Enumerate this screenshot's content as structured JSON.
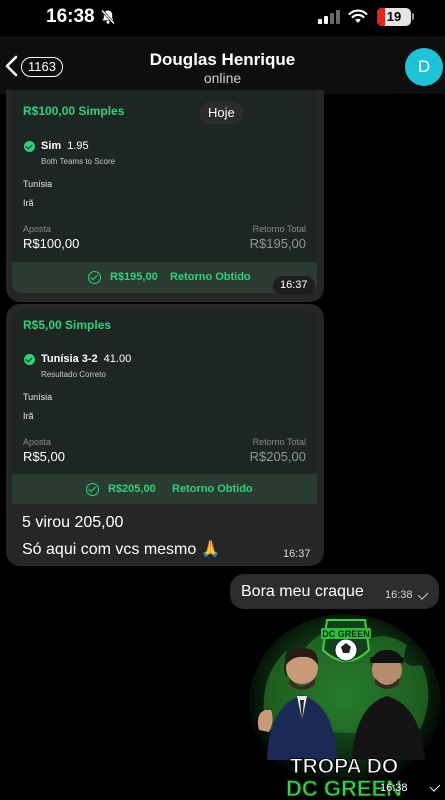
{
  "status_bar": {
    "time": "16:38",
    "battery": "19"
  },
  "header": {
    "back_count": "1163",
    "contact_name": "Douglas Henrique",
    "contact_status": "online",
    "avatar_initial": "D"
  },
  "date_separator": "Hoje",
  "messages": [
    {
      "type": "bet_screenshot",
      "title": "R$100,00 Simples",
      "selection": "Sim",
      "odds": "1.95",
      "market": "Both Teams to Score",
      "team_home": "Tunísia",
      "team_away": "Irã",
      "stake_label": "Aposta",
      "stake": "R$100,00",
      "return_label": "Retorno Total",
      "return_value": "R$195,00",
      "result_amount": "R$195,00",
      "result_text": "Retorno Obtido",
      "time": "16:37"
    },
    {
      "type": "bet_screenshot",
      "title": "R$5,00 Simples",
      "selection": "Tunísia 3-2",
      "odds": "41.00",
      "market": "Resultado Correto",
      "team_home": "Tunísia",
      "team_away": "Irã",
      "stake_label": "Aposta",
      "stake": "R$5,00",
      "return_label": "Retorno Total",
      "return_value": "R$205,00",
      "result_amount": "R$205,00",
      "result_text": "Retorno Obtido",
      "caption_line1": "5 virou 205,00",
      "caption_line2": "Só aqui com vcs mesmo 🙏",
      "time": "16:37"
    },
    {
      "type": "outgoing_text",
      "text": "Bora meu craque",
      "time": "16:38"
    },
    {
      "type": "outgoing_sticker",
      "sticker_badge": "DC GREEN",
      "sticker_line1": "TROPA DO",
      "sticker_line2": "DC GREEN",
      "time": "16:38"
    }
  ],
  "colors": {
    "accent_green": "#2ed17c",
    "avatar": "#1ec3d6",
    "battery_low": "#e5261f"
  }
}
